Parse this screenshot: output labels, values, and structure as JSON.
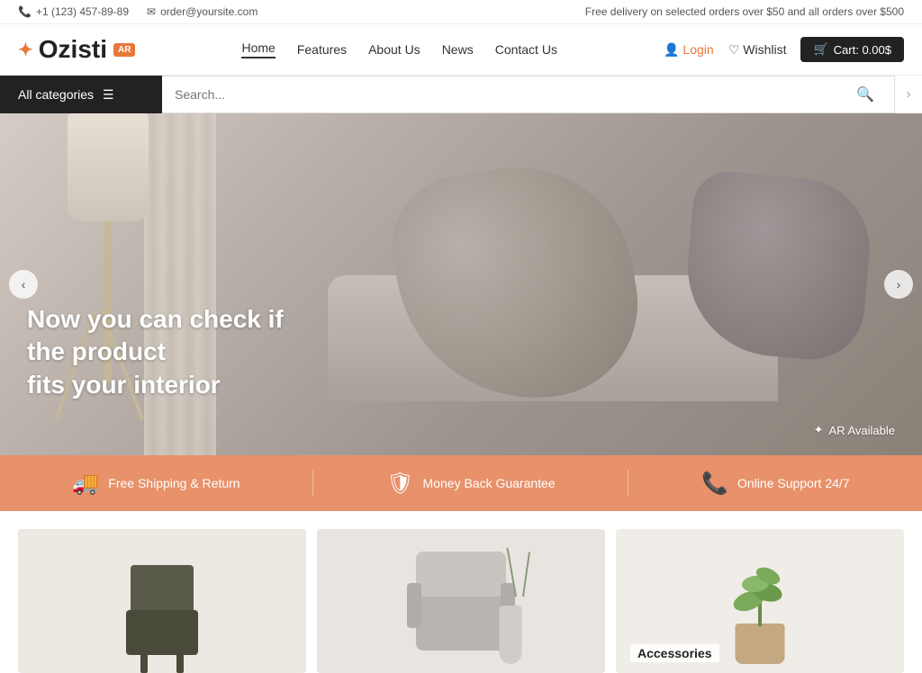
{
  "topbar": {
    "phone": "+1 (123) 457-89-89",
    "email": "order@yoursite.com",
    "delivery_notice": "Free delivery on selected orders over $50 and all orders over $500"
  },
  "header": {
    "logo_text": "Ozisti",
    "logo_ar_badge": "AR",
    "nav": {
      "items": [
        {
          "label": "Home",
          "active": true
        },
        {
          "label": "Features",
          "active": false
        },
        {
          "label": "About Us",
          "active": false
        },
        {
          "label": "News",
          "active": false
        },
        {
          "label": "Contact Us",
          "active": false
        }
      ]
    },
    "login_label": "Login",
    "wishlist_label": "Wishlist",
    "cart_label": "Cart: 0.00$"
  },
  "search": {
    "categories_label": "All categories",
    "placeholder": "Search..."
  },
  "hero": {
    "headline_line1": "Now you can check if the product",
    "headline_line2": "fits your interior",
    "ar_badge": "AR Available",
    "prev_label": "‹",
    "next_label": "›"
  },
  "features": [
    {
      "icon": "🚚",
      "label": "Free Shipping & Return"
    },
    {
      "icon": "🛡",
      "label": "Money Back Guarantee"
    },
    {
      "icon": "📞",
      "label": "Online Support 24/7"
    }
  ],
  "products": [
    {
      "label": ""
    },
    {
      "label": ""
    },
    {
      "label": "Accessories"
    }
  ]
}
